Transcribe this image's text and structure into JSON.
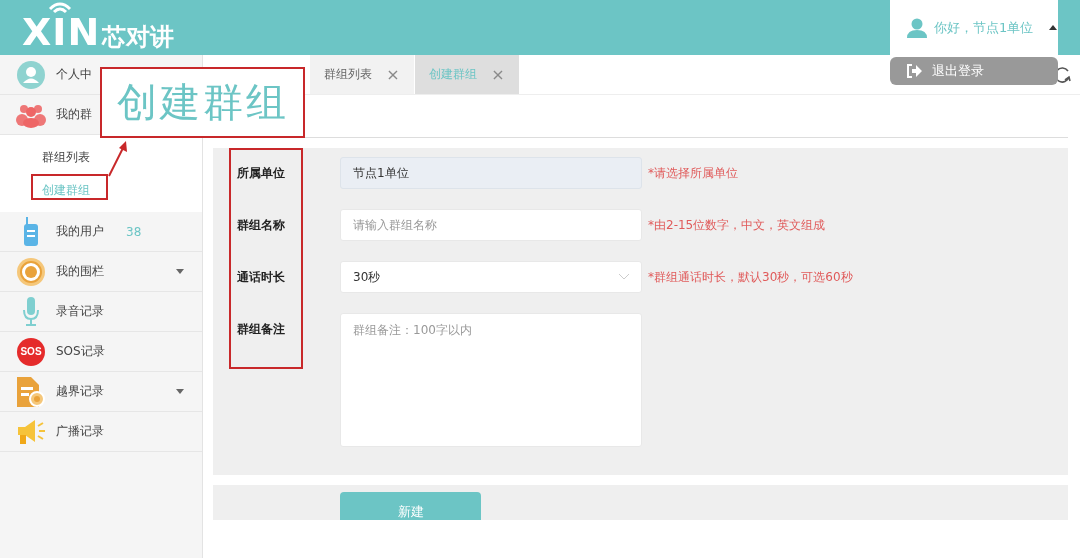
{
  "header": {
    "logo": {
      "mark": "XIN",
      "name": "芯对讲"
    },
    "user": {
      "greeting": "你好，节点1单位",
      "expanded": true
    },
    "user_menu": [
      {
        "label": "退出登录"
      }
    ]
  },
  "sidebar": {
    "items": [
      {
        "label": "个人中",
        "kind": "link"
      },
      {
        "label": "我的群",
        "kind": "menu",
        "expanded": true,
        "children": [
          {
            "label": "群组列表",
            "selected": false
          },
          {
            "label": "创建群组",
            "selected": true
          }
        ]
      },
      {
        "label": "我的用户",
        "kind": "link",
        "count": "38"
      },
      {
        "label": "我的围栏",
        "kind": "menu",
        "expanded": false
      },
      {
        "label": "录音记录",
        "kind": "link"
      },
      {
        "label": "SOS记录",
        "kind": "link",
        "icon_label": "SOS"
      },
      {
        "label": "越界记录",
        "kind": "menu",
        "expanded": false
      },
      {
        "label": "广播记录",
        "kind": "link"
      }
    ]
  },
  "tabs": [
    {
      "label": "群组列表",
      "close": "×",
      "selected": false
    },
    {
      "label": "创建群组",
      "close": "×",
      "selected": true
    }
  ],
  "form": {
    "fields": [
      {
        "label": "所属单位",
        "kind": "text",
        "value": "节点1单位",
        "disabled": true,
        "hint": "*请选择所属单位"
      },
      {
        "label": "群组名称",
        "kind": "text",
        "placeholder": "请输入群组名称",
        "disabled": false,
        "hint": "*由2-15位数字，中文，英文组成"
      },
      {
        "label": "通话时长",
        "kind": "select",
        "value": "30秒",
        "disabled": false,
        "hint": "*群组通话时长，默认30秒，可选60秒"
      },
      {
        "label": "群组备注",
        "kind": "textarea",
        "placeholder": "群组备注：100字以内",
        "disabled": false
      }
    ],
    "submit": "新建"
  },
  "annotation": {
    "callout": "创建群组"
  }
}
